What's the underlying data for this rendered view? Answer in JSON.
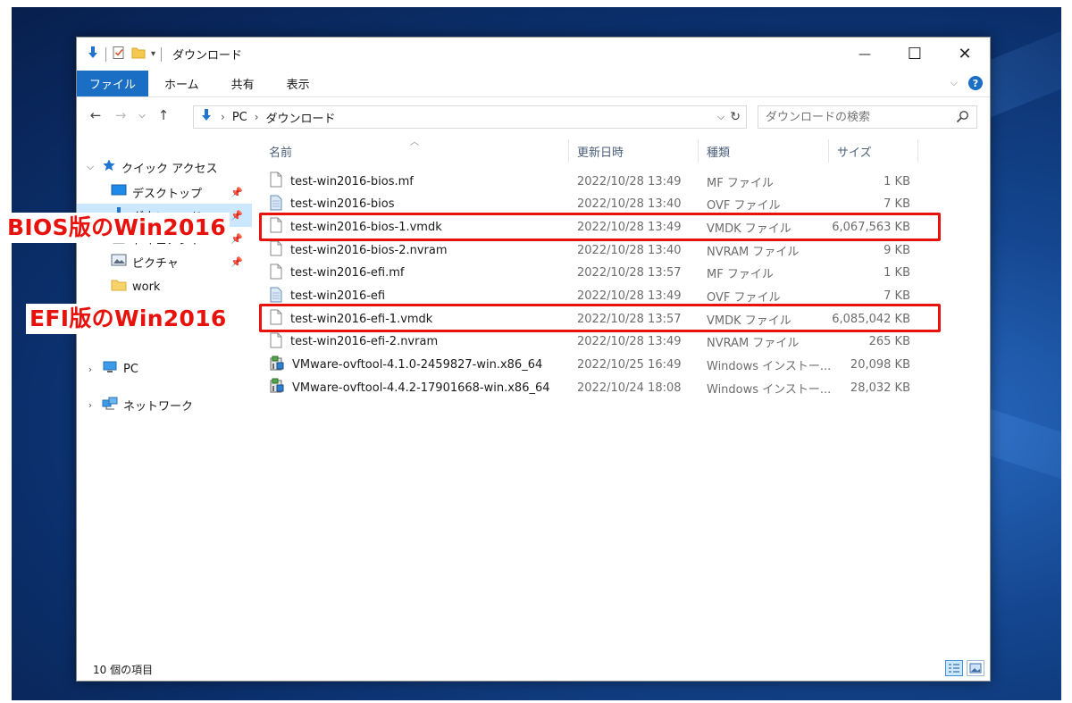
{
  "window": {
    "title": "ダウンロード",
    "controls": {
      "minimize": "—",
      "maximize": "☐",
      "close": "✕"
    }
  },
  "ribbon": {
    "tabs": [
      "ファイル",
      "ホーム",
      "共有",
      "表示"
    ],
    "help": "?"
  },
  "address": {
    "crumbs": [
      "PC",
      "ダウンロード"
    ],
    "search_placeholder": "ダウンロードの検索"
  },
  "nav": {
    "quick_access": "クイック アクセス",
    "items": [
      {
        "label": "デスクトップ",
        "pinned": true
      },
      {
        "label": "ダウンロード",
        "pinned": true
      },
      {
        "label": "ドキュメント",
        "pinned": true
      },
      {
        "label": "ピクチャ",
        "pinned": true
      },
      {
        "label": "work",
        "pinned": false
      }
    ],
    "pc": "PC",
    "network": "ネットワーク"
  },
  "columns": {
    "name": "名前",
    "date": "更新日時",
    "type": "種類",
    "size": "サイズ"
  },
  "files": [
    {
      "name": "test-win2016-bios.mf",
      "date": "2022/10/28 13:49",
      "type": "MF ファイル",
      "size": "1 KB",
      "icon": "blank-file"
    },
    {
      "name": "test-win2016-bios",
      "date": "2022/10/28 13:40",
      "type": "OVF ファイル",
      "size": "7 KB",
      "icon": "ovf-file"
    },
    {
      "name": "test-win2016-bios-1.vmdk",
      "date": "2022/10/28 13:49",
      "type": "VMDK ファイル",
      "size": "6,067,563 KB",
      "icon": "blank-file"
    },
    {
      "name": "test-win2016-bios-2.nvram",
      "date": "2022/10/28 13:40",
      "type": "NVRAM ファイル",
      "size": "9 KB",
      "icon": "blank-file"
    },
    {
      "name": "test-win2016-efi.mf",
      "date": "2022/10/28 13:57",
      "type": "MF ファイル",
      "size": "1 KB",
      "icon": "blank-file"
    },
    {
      "name": "test-win2016-efi",
      "date": "2022/10/28 13:49",
      "type": "OVF ファイル",
      "size": "7 KB",
      "icon": "ovf-file"
    },
    {
      "name": "test-win2016-efi-1.vmdk",
      "date": "2022/10/28 13:57",
      "type": "VMDK ファイル",
      "size": "6,085,042 KB",
      "icon": "blank-file"
    },
    {
      "name": "test-win2016-efi-2.nvram",
      "date": "2022/10/28 13:49",
      "type": "NVRAM ファイル",
      "size": "265 KB",
      "icon": "blank-file"
    },
    {
      "name": "VMware-ovftool-4.1.0-2459827-win.x86_64",
      "date": "2022/10/25 16:49",
      "type": "Windows インストー...",
      "size": "20,098 KB",
      "icon": "installer"
    },
    {
      "name": "VMware-ovftool-4.4.2-17901668-win.x86_64",
      "date": "2022/10/24 18:08",
      "type": "Windows インストー...",
      "size": "28,032 KB",
      "icon": "installer"
    }
  ],
  "status": {
    "count": "10 個の項目"
  },
  "annotations": {
    "bios": "BIOS版のWin2016",
    "efi": "EFI版のWin2016",
    "color": "#e8120c"
  }
}
